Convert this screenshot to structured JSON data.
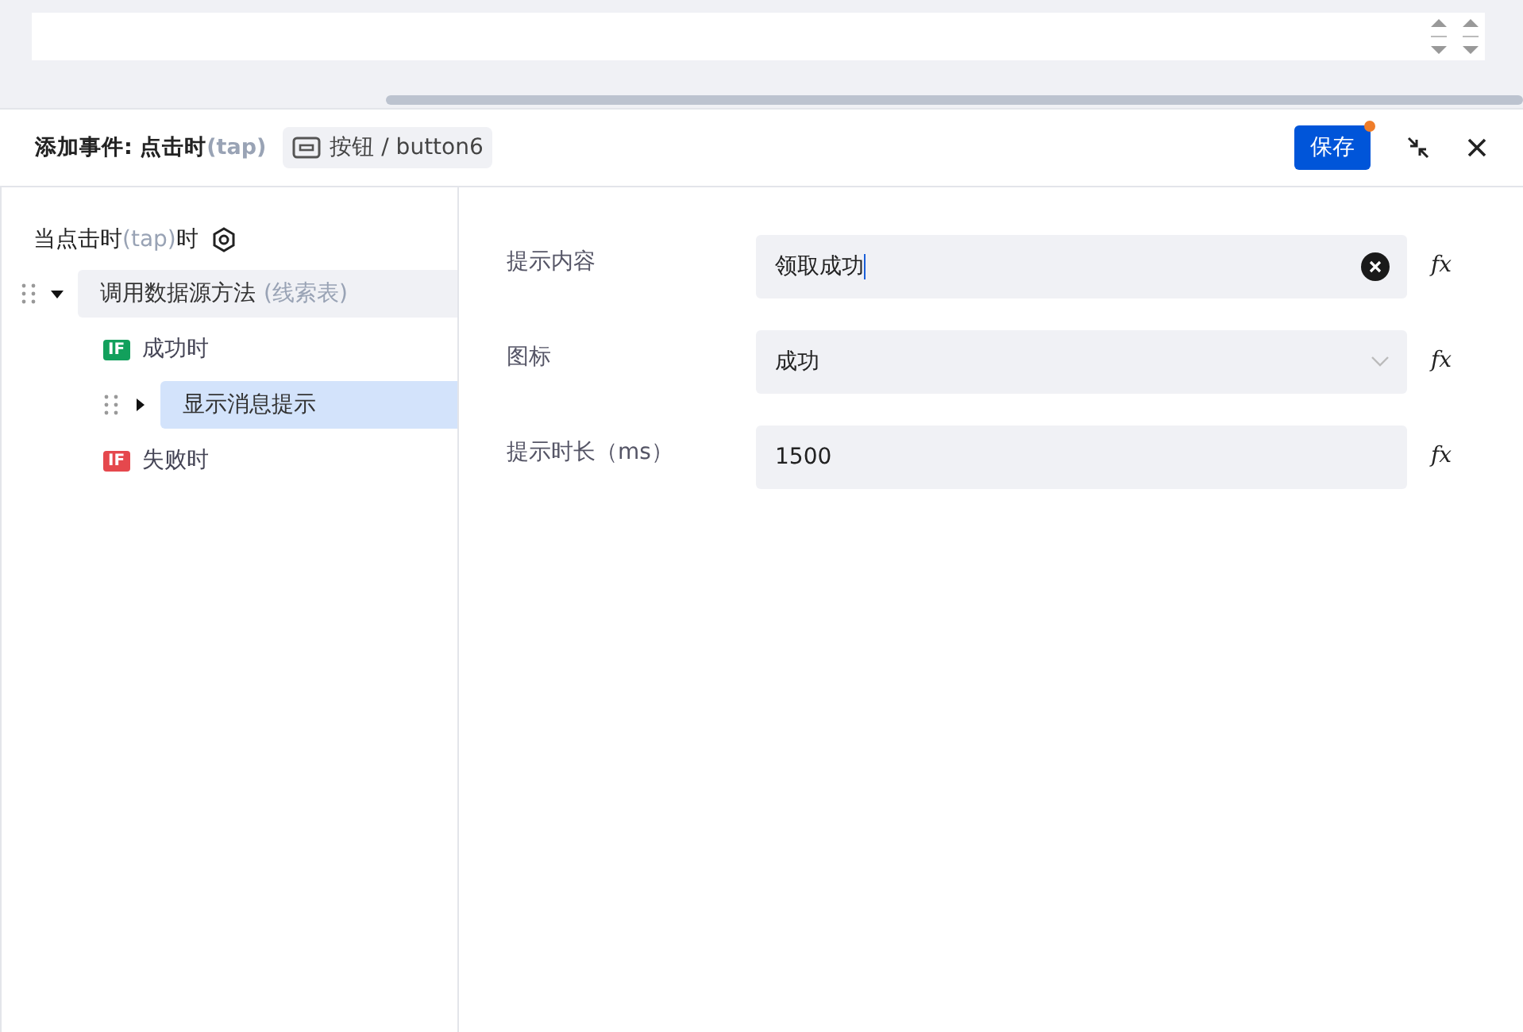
{
  "header": {
    "title": "添加事件: 点击时",
    "title_note": "(tap)",
    "target": "按钮 / button6",
    "save": {
      "label": "保存",
      "unsaved": true
    }
  },
  "trigger": {
    "prefix": "当点击时",
    "note": "(tap)",
    "suffix": "时"
  },
  "tree": [
    {
      "kind": "action",
      "label": "调用数据源方法",
      "note": "(线索表)",
      "expanded": true,
      "selected": false,
      "children": [
        {
          "kind": "branch",
          "tag": "IF",
          "label": "成功时",
          "color": "#12a05c",
          "children": [
            {
              "kind": "action",
              "label": "显示消息提示",
              "expanded": false,
              "selected": true
            }
          ]
        },
        {
          "kind": "branch",
          "tag": "IF",
          "label": "失败时",
          "color": "#e5484d"
        }
      ]
    }
  ],
  "fields": [
    {
      "kind": "input",
      "label": "提示内容",
      "value": "领取成功",
      "focused": true,
      "clearable": true,
      "fx": "fx"
    },
    {
      "kind": "select",
      "label": "图标",
      "value": "成功",
      "focused": false,
      "clearable": false,
      "fx": "fx"
    },
    {
      "kind": "input",
      "label": "提示时长（ms）",
      "value": "1500",
      "focused": false,
      "clearable": false,
      "fx": "fx"
    }
  ]
}
